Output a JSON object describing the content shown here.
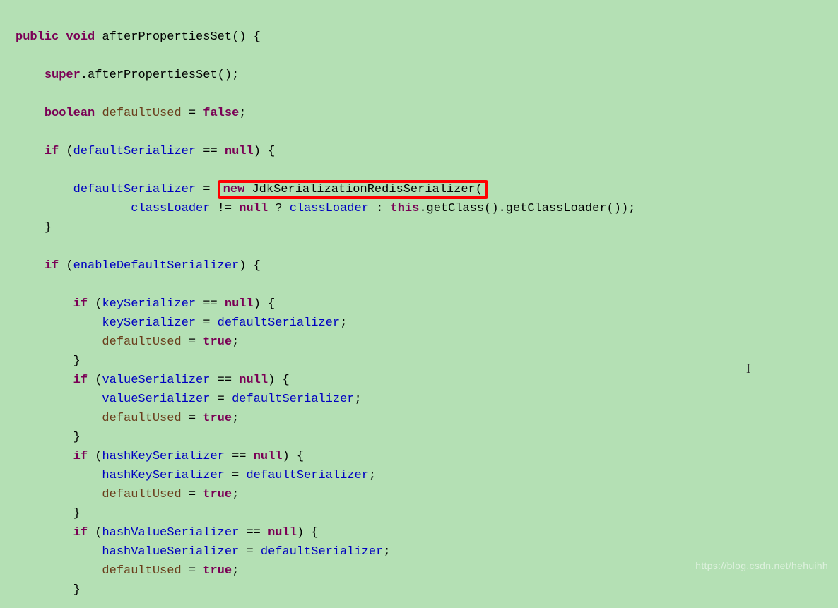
{
  "code": {
    "line1_public": "public",
    "line1_void": "void",
    "line1_method": "afterPropertiesSet() {",
    "line3_super": "super",
    "line3_rest": ".afterPropertiesSet();",
    "line5_boolean": "boolean",
    "line5_var": "defaultUsed",
    "line5_eq": " = ",
    "line5_false": "false",
    "line5_semi": ";",
    "line7_if": "if",
    "line7_open": " (",
    "line7_field": "defaultSerializer",
    "line7_eqop": " == ",
    "line7_null": "null",
    "line7_close": ") {",
    "line9_field": "defaultSerializer",
    "line9_eq": " = ",
    "line9_new": "new",
    "line9_ctor": " JdkSerializationRedisSerializer(",
    "line10_field1": "classLoader",
    "line10_neq": " != ",
    "line10_null": "null",
    "line10_tern": " ? ",
    "line10_field2": "classLoader",
    "line10_colon": " : ",
    "line10_this": "this",
    "line10_rest": ".getClass().getClassLoader());",
    "line11_close": "}",
    "line13_if": "if",
    "line13_open": " (",
    "line13_field": "enableDefaultSerializer",
    "line13_close": ") {",
    "line15_if": "if",
    "line15_open": " (",
    "line15_field": "keySerializer",
    "line15_eqop": " == ",
    "line15_null": "null",
    "line15_close": ") {",
    "line16_field1": "keySerializer",
    "line16_eq": " = ",
    "line16_field2": "defaultSerializer",
    "line16_semi": ";",
    "line17_var": "defaultUsed",
    "line17_eq": " = ",
    "line17_true": "true",
    "line17_semi": ";",
    "line18_close": "}",
    "line19_if": "if",
    "line19_open": " (",
    "line19_field": "valueSerializer",
    "line19_eqop": " == ",
    "line19_null": "null",
    "line19_close": ") {",
    "line20_field1": "valueSerializer",
    "line20_eq": " = ",
    "line20_field2": "defaultSerializer",
    "line20_semi": ";",
    "line21_var": "defaultUsed",
    "line21_eq": " = ",
    "line21_true": "true",
    "line21_semi": ";",
    "line22_close": "}",
    "line23_if": "if",
    "line23_open": " (",
    "line23_field": "hashKeySerializer",
    "line23_eqop": " == ",
    "line23_null": "null",
    "line23_close": ") {",
    "line24_field1": "hashKeySerializer",
    "line24_eq": " = ",
    "line24_field2": "defaultSerializer",
    "line24_semi": ";",
    "line25_var": "defaultUsed",
    "line25_eq": " = ",
    "line25_true": "true",
    "line25_semi": ";",
    "line26_close": "}",
    "line27_if": "if",
    "line27_open": " (",
    "line27_field": "hashValueSerializer",
    "line27_eqop": " == ",
    "line27_null": "null",
    "line27_close": ") {",
    "line28_field1": "hashValueSerializer",
    "line28_eq": " = ",
    "line28_field2": "defaultSerializer",
    "line28_semi": ";",
    "line29_var": "defaultUsed",
    "line29_eq": " = ",
    "line29_true": "true",
    "line29_semi": ";",
    "line30_close": "}"
  },
  "watermark": "https://blog.csdn.net/hehuihh",
  "cursor": "I"
}
